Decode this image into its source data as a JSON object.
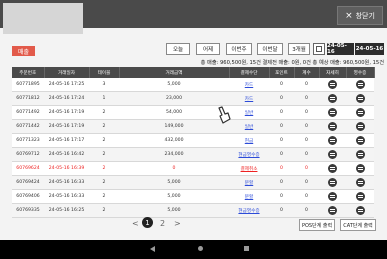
{
  "header": {
    "close_label": "창닫기"
  },
  "sale_label": "매출",
  "filters": [
    "오늘",
    "어제",
    "이번주",
    "이번달",
    "3개월"
  ],
  "date_from": "24-05-16",
  "date_to": "24-05-16",
  "summary": "총 매출: 960,500원, 15건   결제전 매출: 0원, 0건   총 예상 매출: 960,500원, 15건",
  "table": {
    "headers": [
      "주문번호",
      "거래일자",
      "테이블",
      "거래금액",
      "결제수단",
      "포인트",
      "계수",
      "자세히",
      "영수증"
    ],
    "rows": [
      {
        "order": "60771895",
        "date": "24-05-16 17:25",
        "table": "3",
        "amount": "5,000",
        "method": "카드",
        "point": "0",
        "count": "0",
        "cancel": false
      },
      {
        "order": "60771812",
        "date": "24-05-16 17:24",
        "table": "1",
        "amount": "23,000",
        "method": "카드",
        "point": "0",
        "count": "0",
        "cancel": false
      },
      {
        "order": "60771492",
        "date": "24-05-16 17:19",
        "table": "2",
        "amount": "54,000",
        "method": "일반",
        "point": "0",
        "count": "0",
        "cancel": false
      },
      {
        "order": "60771442",
        "date": "24-05-16 17:19",
        "table": "2",
        "amount": "149,000",
        "method": "일반",
        "point": "0",
        "count": "0",
        "cancel": false
      },
      {
        "order": "60771323",
        "date": "24-05-16 17:17",
        "table": "2",
        "amount": "432,000",
        "method": "현금",
        "point": "0",
        "count": "0",
        "cancel": false
      },
      {
        "order": "60769712",
        "date": "24-05-16 16:42",
        "table": "2",
        "amount": "234,000",
        "method": "현금영수증",
        "point": "0",
        "count": "0",
        "cancel": false
      },
      {
        "order": "60769624",
        "date": "24-05-16 16:39",
        "table": "2",
        "amount": "0",
        "method": "결제취소",
        "point": "0",
        "count": "0",
        "cancel": true
      },
      {
        "order": "60769424",
        "date": "24-05-16 16:33",
        "table": "2",
        "amount": "5,000",
        "method": "분할",
        "point": "0",
        "count": "0",
        "cancel": false
      },
      {
        "order": "60769406",
        "date": "24-05-16 16:33",
        "table": "2",
        "amount": "5,000",
        "method": "분할",
        "point": "0",
        "count": "0",
        "cancel": false
      },
      {
        "order": "60769335",
        "date": "24-05-16 16:25",
        "table": "2",
        "amount": "5,000",
        "method": "현금영수증",
        "point": "0",
        "count": "0",
        "cancel": false
      }
    ]
  },
  "pagination": {
    "prev": "<",
    "current": "1",
    "next_page": "2",
    "next": ">"
  },
  "footer": {
    "pos_print": "POS단계 출력",
    "cat_print": "CAT단계 출력"
  }
}
